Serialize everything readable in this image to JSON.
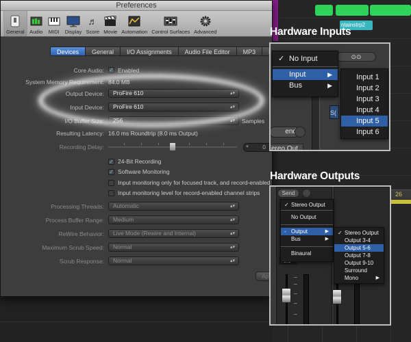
{
  "window": {
    "title": "Preferences"
  },
  "toolbar": {
    "items": [
      {
        "label": "General",
        "icon": "switch-icon",
        "active": true
      },
      {
        "label": "Audio",
        "icon": "audio-meter-icon"
      },
      {
        "label": "MIDI",
        "icon": "midi-keyboard-icon"
      },
      {
        "label": "Display",
        "icon": "display-icon"
      },
      {
        "label": "Score",
        "icon": "score-icon"
      },
      {
        "label": "Movie",
        "icon": "movie-clapper-icon"
      },
      {
        "label": "Automation",
        "icon": "automation-icon"
      },
      {
        "label": "Control Surfaces",
        "icon": "control-surfaces-icon"
      },
      {
        "label": "Advanced",
        "icon": "advanced-gear-icon"
      }
    ]
  },
  "tabs": [
    {
      "label": "Devices",
      "active": true
    },
    {
      "label": "General"
    },
    {
      "label": "I/O Assignments"
    },
    {
      "label": "Audio File Editor"
    },
    {
      "label": "MP3"
    },
    {
      "label": "Res"
    }
  ],
  "settings": {
    "core_audio_label": "Core Audio:",
    "core_audio_value": "Enabled",
    "system_memory_label": "System Memory Requirement:",
    "system_memory_value": "84.0 MB",
    "output_device_label": "Output Device:",
    "output_device_value": "ProFire 610",
    "input_device_label": "Input Device:",
    "input_device_value": "ProFire 610",
    "io_buffer_label": "I/O Buffer Size:",
    "io_buffer_value": "256",
    "io_buffer_unit": "Samples",
    "latency_label": "Resulting Latency:",
    "latency_value": "16.0 ms Roundtrip (8.0 ms Output)",
    "recording_delay_label": "Recording Delay:",
    "recording_delay_value": "0",
    "check_24bit": "24-Bit Recording",
    "check_software_monitoring": "Software Monitoring",
    "check_input_focused": "Input monitoring only for focused track, and record-enabled tracks",
    "check_input_level": "Input monitoring level for record-enabled channel strips",
    "processing_threads_label": "Processing Threads:",
    "processing_threads_value": "Automatic",
    "process_buffer_label": "Process Buffer Range:",
    "process_buffer_value": "Medium",
    "rewire_label": "ReWire Behavior:",
    "rewire_value": "Live Mode (Rewire and Internal)",
    "max_scrub_label": "Maximum Scrub Speed:",
    "max_scrub_value": "Normal",
    "scrub_response_label": "Scrub Response:",
    "scrub_response_value": "Normal",
    "apply_label": "Ap"
  },
  "hardware_inputs": {
    "title": "Hardware Inputs",
    "menu": {
      "no_input": "No Input",
      "input": "Input",
      "bus": "Bus"
    },
    "submenu": [
      "Input 1",
      "Input 2",
      "Input 3",
      "Input 4",
      "Input 5",
      "Input 6"
    ],
    "selected": "Input 5",
    "partial_labels": {
      "send": "end",
      "stereo_out": "ereo Out",
      "s": "S("
    }
  },
  "hardware_outputs": {
    "title": "Hardware Outputs",
    "send_label": "Send",
    "menu": {
      "stereo_output": "Stereo Output",
      "no_output": "No Output",
      "output": "Output",
      "bus": "Bus",
      "binaural": "Binaural"
    },
    "submenu": [
      "Stereo Output",
      "Output 3-4",
      "Output 5-6",
      "Output 7-8",
      "Output 9-10",
      "Surround",
      "Mono"
    ],
    "selected": "Output 5-6",
    "level_value": "+0.3"
  },
  "background": {
    "track_name": "ntainstrp2",
    "bar_number": "26"
  }
}
